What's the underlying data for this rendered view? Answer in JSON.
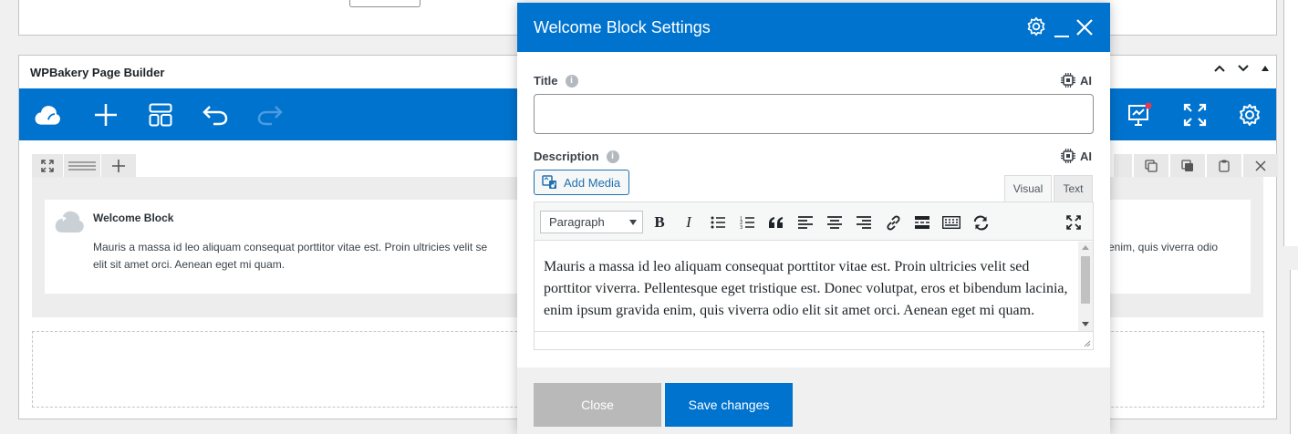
{
  "builder": {
    "panel_title": "WPBakery Page Builder",
    "element": {
      "title": "Welcome Block",
      "description_left": "Mauris a massa id leo aliquam consequat porttitor vitae est. Proin ultricies velit sed porttitor viverra. Pellentesque eget tristique est. Donec volutpat, eros et bibendum lacinia, enim ipsum gravida enim, quis viverra odio elit sit amet orci. Aenean eget mi quam.",
      "description_visible_1": "Mauris a massa id leo aliquam consequat porttitor vitae est. Proin ultricies velit se",
      "description_visible_2": "elit sit amet orci. Aenean eget mi quam.",
      "description_right": "enim, quis viverra odio"
    },
    "icons": [
      "cloud-logo-icon",
      "plus-icon",
      "layout-icon",
      "undo-icon",
      "redo-icon",
      "presentation-icon",
      "fullscreen-icon",
      "gear-icon"
    ]
  },
  "modal": {
    "title": "Welcome Block Settings",
    "fields": {
      "title_label": "Title",
      "title_value": "",
      "ai_label": "AI",
      "description_label": "Description",
      "add_media_label": "Add Media",
      "tab_visual": "Visual",
      "tab_text": "Text",
      "format_value": "Paragraph",
      "content": "Mauris a massa id leo aliquam consequat porttitor vitae est. Proin ultricies velit sed porttitor viverra. Pellentesque eget tristique est. Donec volutpat, eros et bibendum lacinia, enim ipsum gravida enim, quis viverra odio elit sit amet orci. Aenean eget mi quam."
    },
    "footer": {
      "close_label": "Close",
      "save_label": "Save changes"
    }
  },
  "colors": {
    "brand_blue": "#0073cf",
    "close_grey": "#b9b9b9"
  }
}
